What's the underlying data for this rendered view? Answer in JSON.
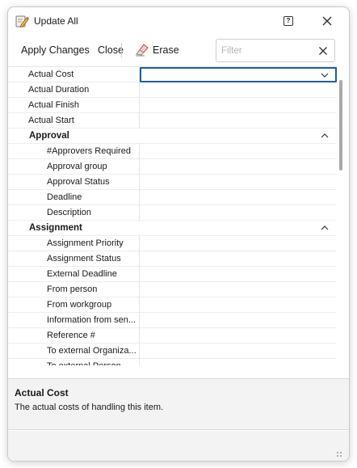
{
  "window": {
    "title": "Update All",
    "icons": {
      "app": "edit-note-icon",
      "help": "help-icon",
      "close": "close-icon"
    }
  },
  "toolbar": {
    "apply_label": "Apply Changes",
    "close_label": "Close",
    "erase_label": "Erase",
    "erase_icon": "eraser-icon",
    "filter_placeholder": "Filter",
    "filter_value": ""
  },
  "grid": {
    "top_rows": [
      {
        "label": "Actual Cost",
        "value": "",
        "selected": true
      },
      {
        "label": "Actual Duration",
        "value": ""
      },
      {
        "label": "Actual Finish",
        "value": ""
      },
      {
        "label": "Actual Start",
        "value": ""
      }
    ],
    "categories": [
      {
        "label": "Approval",
        "rows": [
          {
            "label": "#Approvers Required",
            "value": ""
          },
          {
            "label": "Approval group",
            "value": ""
          },
          {
            "label": "Approval Status",
            "value": ""
          },
          {
            "label": "Deadline",
            "value": ""
          },
          {
            "label": "Description",
            "value": ""
          }
        ]
      },
      {
        "label": "Assignment",
        "rows": [
          {
            "label": "Assignment Priority",
            "value": ""
          },
          {
            "label": "Assignment Status",
            "value": ""
          },
          {
            "label": "External Deadline",
            "value": ""
          },
          {
            "label": "From person",
            "value": ""
          },
          {
            "label": "From workgroup",
            "value": ""
          },
          {
            "label": "Information from sen...",
            "value": ""
          },
          {
            "label": "Reference #",
            "value": ""
          },
          {
            "label": "To external Organiza...",
            "value": ""
          },
          {
            "label": "To external Person",
            "value": ""
          }
        ]
      }
    ]
  },
  "description": {
    "title": "Actual Cost",
    "text": "The actual costs of handling this item."
  },
  "colors": {
    "accent": "#1f5f9f",
    "panel": "#f3f3f3"
  }
}
